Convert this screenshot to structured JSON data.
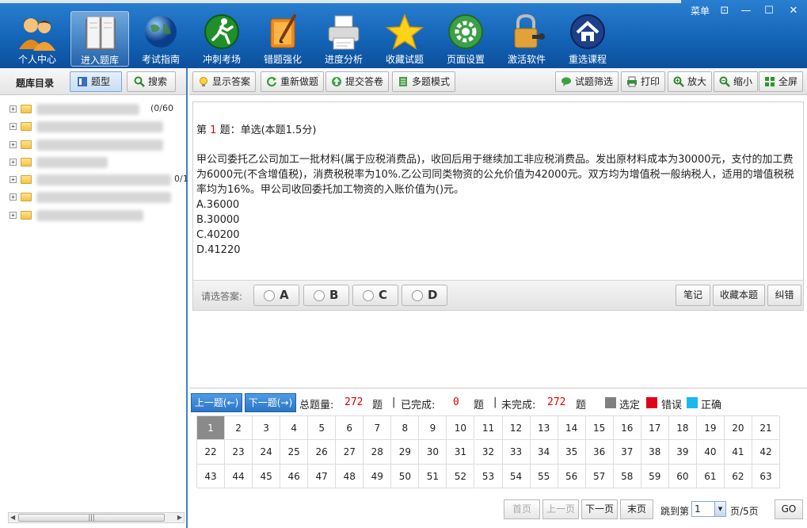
{
  "window": {
    "menu_label": "菜单",
    "controls": [
      "⊡",
      "—",
      "☐",
      "✕"
    ]
  },
  "toolbar": {
    "items": [
      {
        "label": "个人中心",
        "icon": "people-icon"
      },
      {
        "label": "进入题库",
        "icon": "book-icon"
      },
      {
        "label": "考试指南",
        "icon": "globe-icon"
      },
      {
        "label": "冲刺考场",
        "icon": "runner-icon"
      },
      {
        "label": "错题强化",
        "icon": "paint-brush-icon"
      },
      {
        "label": "进度分析",
        "icon": "printer-icon"
      },
      {
        "label": "收藏试题",
        "icon": "star-icon"
      },
      {
        "label": "页面设置",
        "icon": "gear-icon"
      },
      {
        "label": "激活软件",
        "icon": "lock-key-icon"
      },
      {
        "label": "重选课程",
        "icon": "home-icon"
      }
    ],
    "active_index": 1
  },
  "sidebar": {
    "title": "题库目录",
    "type_button": "题型",
    "search_button": "搜索",
    "tree_counts": [
      "(0/60",
      "0/1"
    ]
  },
  "main_toolbar": {
    "show_answer": "显示答案",
    "redo": "重新做题",
    "submit": "提交答卷",
    "multi_mode": "多题模式",
    "filter": "试题筛选",
    "print": "打印",
    "zoom_in": "放大",
    "zoom_out": "缩小",
    "fullscreen": "全屏"
  },
  "question": {
    "prefix": "第",
    "number": "1",
    "suffix": "题：单选(本题1.5分)",
    "text": "甲公司委托乙公司加工一批材料(属于应税消费品)，收回后用于继续加工非应税消费品。发出原材料成本为30000元，支付的加工费为6000元(不含增值税)，消费税税率为10%.乙公司同类物资的公允价值为42000元。双方均为增值税一般纳税人，适用的增值税税率均为16%。甲公司收回委托加工物资的入账价值为()元。",
    "options": [
      "A.36000",
      "B.30000",
      "C.40200",
      "D.41220"
    ]
  },
  "answer": {
    "label": "请选答案:",
    "choices": [
      "A",
      "B",
      "C",
      "D"
    ],
    "note": "笔记",
    "favorite": "收藏本题",
    "correct_error": "纠错"
  },
  "nav": {
    "prev": "上一题(←)",
    "next": "下一题(→)",
    "total_label": "总题量:",
    "total": "272",
    "unit1": "题",
    "sep1": "|",
    "done_label": "已完成:",
    "done": "0",
    "unit2": "题",
    "sep2": "|",
    "todo_label": "未完成:",
    "todo": "272",
    "unit3": "题",
    "legend_selected": "选定",
    "legend_wrong": "错误",
    "legend_correct": "正确",
    "colors": {
      "selected": "#808080",
      "wrong": "#e0001b",
      "correct": "#1ab8f0"
    }
  },
  "grid": {
    "numbers": [
      1,
      2,
      3,
      4,
      5,
      6,
      7,
      8,
      9,
      10,
      11,
      12,
      13,
      14,
      15,
      16,
      17,
      18,
      19,
      20,
      21,
      22,
      23,
      24,
      25,
      26,
      27,
      28,
      29,
      30,
      31,
      32,
      33,
      34,
      35,
      36,
      37,
      38,
      39,
      40,
      41,
      42,
      43,
      44,
      45,
      46,
      47,
      48,
      49,
      50,
      51,
      52,
      53,
      54,
      55,
      56,
      57,
      58,
      59,
      60,
      61,
      62,
      63
    ],
    "selected": 1
  },
  "pager": {
    "first": "首页",
    "prev": "上一页",
    "next": "下一页",
    "last": "末页",
    "jump_label": "跳到第",
    "page_value": "1",
    "page_suffix": "页/5页",
    "go": "GO"
  }
}
